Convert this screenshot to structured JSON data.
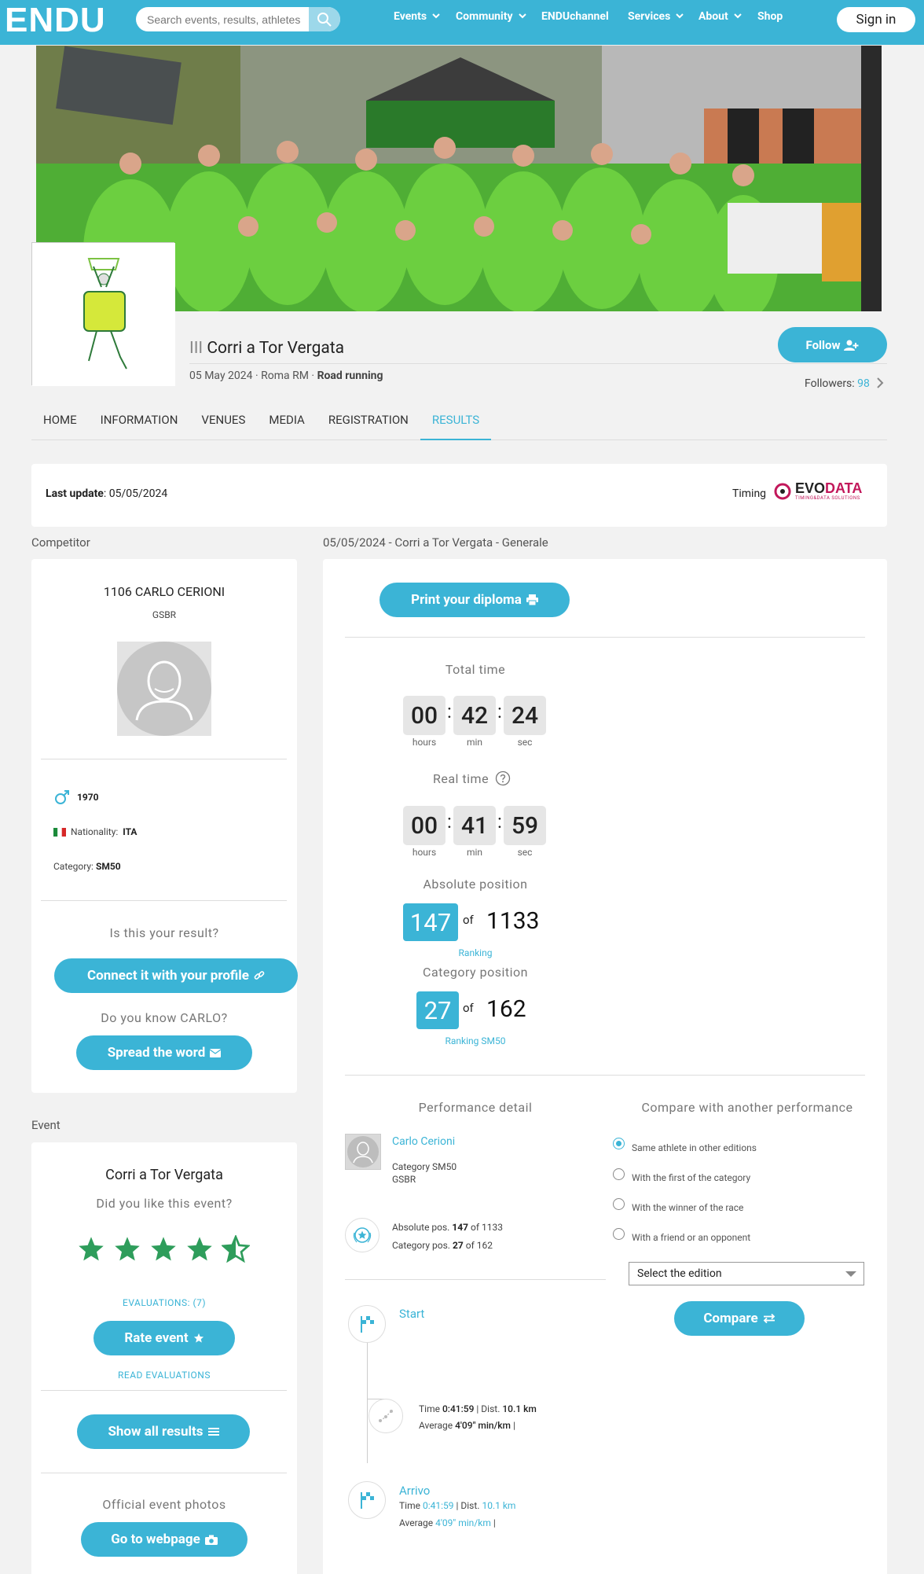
{
  "topbar": {
    "logo": "ENDU",
    "search_placeholder": "Search events, results, athletes",
    "nav": [
      "Events",
      "Community",
      "ENDUchannel",
      "Services",
      "About",
      "Shop"
    ],
    "nav_dropdown": [
      true,
      true,
      false,
      true,
      true,
      false
    ],
    "sign_in": "Sign in"
  },
  "event": {
    "edition": "III",
    "name": "Corri a Tor Vergata",
    "date": "05 May 2024",
    "location": "Roma RM",
    "discipline": "Road running",
    "follow_label": "Follow",
    "followers_label": "Followers:",
    "followers_count": "98"
  },
  "tabs": [
    "HOME",
    "INFORMATION",
    "VENUES",
    "MEDIA",
    "REGISTRATION",
    "RESULTS"
  ],
  "active_tab": "RESULTS",
  "update": {
    "label": "Last update",
    "date": "05/05/2024",
    "timing_label": "Timing",
    "timing_brand_1": "EVO",
    "timing_brand_2": "DATA",
    "timing_tagline": "TIMING&DATA SOLUTIONS"
  },
  "competitor": {
    "section_label": "Competitor",
    "bib_name": "1106 CARLO CERIONI",
    "team": "GSBR",
    "birth_year": "1970",
    "nationality_label": "Nationality:",
    "nationality": "ITA",
    "category_label": "Category:",
    "category": "SM50",
    "is_your_result": "Is this your result?",
    "connect_label": "Connect it with your profile",
    "know_label": "Do you know CARLO?",
    "spread_label": "Spread the word"
  },
  "event_card": {
    "section_label": "Event",
    "name": "Corri a Tor Vergata",
    "question": "Did you like this event?",
    "rating": 4.5,
    "evaluations_label": "EVALUATIONS: (7)",
    "rate_label": "Rate event",
    "read_label": "READ EVALUATIONS",
    "show_all_label": "Show all results",
    "photos_label": "Official event photos",
    "webpage_label": "Go to webpage"
  },
  "result": {
    "section_label": "05/05/2024 - Corri a Tor Vergata - Generale",
    "print_label": "Print your diploma",
    "total_time_label": "Total time",
    "total_time": {
      "hours": "00",
      "min": "42",
      "sec": "24"
    },
    "real_time_label": "Real time",
    "real_time": {
      "hours": "00",
      "min": "41",
      "sec": "59"
    },
    "units": {
      "hours": "hours",
      "min": "min",
      "sec": "sec"
    },
    "absolute_label": "Absolute position",
    "absolute_pos": "147",
    "absolute_total": "1133",
    "of": "of",
    "ranking_label": "Ranking",
    "category_label": "Category position",
    "category_pos": "27",
    "category_total": "162",
    "ranking_cat_label": "Ranking SM50"
  },
  "performance": {
    "title": "Performance detail",
    "athlete": "Carlo Cerioni",
    "category": "Category SM50",
    "team": "GSBR",
    "abs_pos_label": "Absolute pos.",
    "abs_pos": "147",
    "abs_total": "1133",
    "cat_pos_label": "Category pos.",
    "cat_pos": "27",
    "cat_total": "162",
    "of": "of",
    "start_label": "Start",
    "split_time_label": "Time",
    "split_time": "0:41:59",
    "dist_label": "Dist.",
    "split_dist": "10.1 km",
    "average_label": "Average",
    "split_avg": "4'09\" min/km",
    "finish_label": "Arrivo",
    "finish_time": "0:41:59",
    "finish_dist": "10.1 km",
    "finish_avg": "4'09\" min/km"
  },
  "compare": {
    "title": "Compare with another performance",
    "options": [
      "Same athlete in other editions",
      "With the first of the category",
      "With the winner of the race",
      "With a friend or an opponent"
    ],
    "selected_index": 0,
    "select_value": "Select the edition",
    "compare_label": "Compare"
  },
  "colors": {
    "accent": "#3bb4d6",
    "star": "#2e9d5b"
  }
}
